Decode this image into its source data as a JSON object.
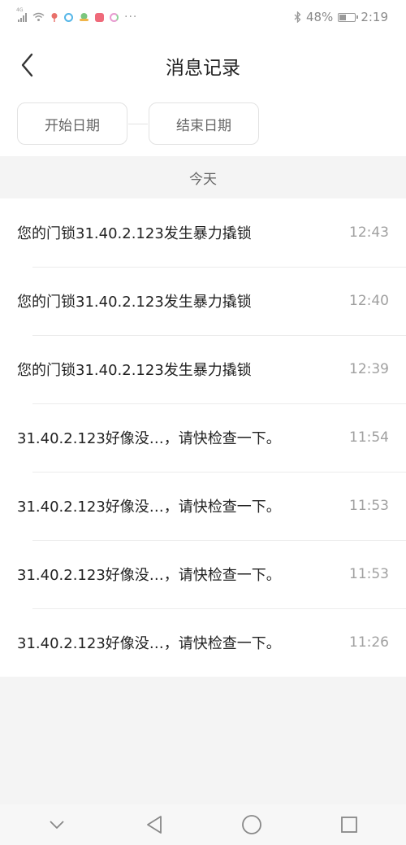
{
  "status_bar": {
    "network": "4G",
    "battery_percent": "48%",
    "battery_level": 0.48,
    "time": "2:19",
    "more": "···"
  },
  "header": {
    "title": "消息记录"
  },
  "filter": {
    "start_label": "开始日期",
    "end_label": "结束日期"
  },
  "section": {
    "label": "今天"
  },
  "messages": [
    {
      "text": "您的门锁31.40.2.123发生暴力撬锁",
      "time": "12:43"
    },
    {
      "text": "您的门锁31.40.2.123发生暴力撬锁",
      "time": "12:40"
    },
    {
      "text": "您的门锁31.40.2.123发生暴力撬锁",
      "time": "12:39"
    },
    {
      "text": "31.40.2.123好像没…，请快检查一下。",
      "time": "11:54"
    },
    {
      "text": "31.40.2.123好像没…，请快检查一下。",
      "time": "11:53"
    },
    {
      "text": "31.40.2.123好像没…，请快检查一下。",
      "time": "11:53"
    },
    {
      "text": "31.40.2.123好像没…，请快检查一下。",
      "time": "11:26"
    }
  ],
  "icons": {
    "back": "chevron-left-icon",
    "nav_collapse": "chevron-down-icon",
    "nav_back": "triangle-back-icon",
    "nav_home": "circle-home-icon",
    "nav_recents": "square-recents-icon"
  }
}
